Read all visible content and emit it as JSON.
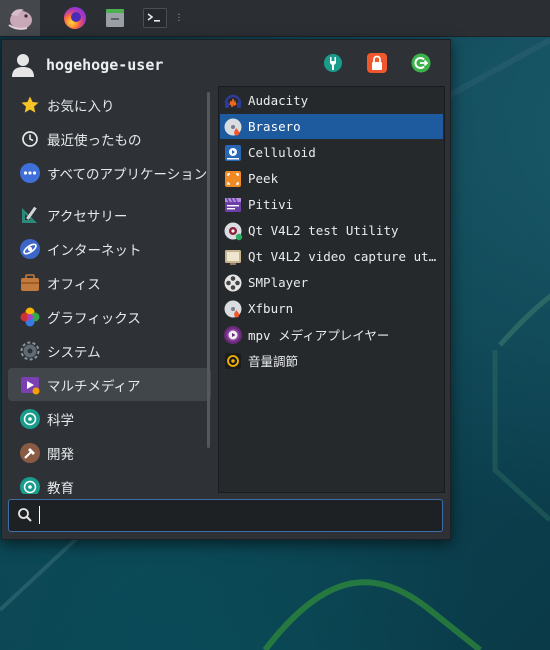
{
  "panel": {
    "launchers": [
      {
        "name": "firefox",
        "icon": "firefox-icon"
      },
      {
        "name": "file-manager",
        "icon": "file-manager-icon"
      },
      {
        "name": "terminal",
        "icon": "terminal-icon"
      }
    ]
  },
  "user": {
    "name": "hogehoge-user"
  },
  "actions": [
    {
      "icon": "settings-manager-icon",
      "color": "#1a9c8c"
    },
    {
      "icon": "lock-screen-icon",
      "color": "#f0572d"
    },
    {
      "icon": "log-out-icon",
      "color": "#3bb34a"
    }
  ],
  "categories": [
    {
      "label": "お気に入り",
      "icon": "star-icon"
    },
    {
      "label": "最近使ったもの",
      "icon": "clock-icon"
    },
    {
      "label": "すべてのアプリケーション",
      "icon": "all-apps-icon"
    },
    {
      "label": "アクセサリー",
      "icon": "accessories-icon"
    },
    {
      "label": "インターネット",
      "icon": "internet-icon"
    },
    {
      "label": "オフィス",
      "icon": "office-icon"
    },
    {
      "label": "グラフィックス",
      "icon": "graphics-icon"
    },
    {
      "label": "システム",
      "icon": "system-icon"
    },
    {
      "label": "マルチメディア",
      "icon": "multimedia-icon"
    },
    {
      "label": "科学",
      "icon": "science-icon"
    },
    {
      "label": "開発",
      "icon": "development-icon"
    },
    {
      "label": "教育",
      "icon": "education-icon"
    }
  ],
  "selected_category": "マルチメディア",
  "apps": [
    {
      "label": "Audacity",
      "icon": "audacity-icon"
    },
    {
      "label": "Brasero",
      "icon": "brasero-icon"
    },
    {
      "label": "Celluloid",
      "icon": "celluloid-icon"
    },
    {
      "label": "Peek",
      "icon": "peek-icon"
    },
    {
      "label": "Pitivi",
      "icon": "pitivi-icon"
    },
    {
      "label": "Qt V4L2 test Utility",
      "icon": "qv4l2-icon"
    },
    {
      "label": "Qt V4L2 video capture uti…",
      "icon": "qvidcap-icon"
    },
    {
      "label": "SMPlayer",
      "icon": "smplayer-icon"
    },
    {
      "label": "Xfburn",
      "icon": "xfburn-icon"
    },
    {
      "label": "mpv メディアプレイヤー",
      "icon": "mpv-icon"
    },
    {
      "label": "音量調節",
      "icon": "volume-control-icon"
    }
  ],
  "selected_app": "Brasero",
  "search": {
    "value": "",
    "placeholder": ""
  }
}
